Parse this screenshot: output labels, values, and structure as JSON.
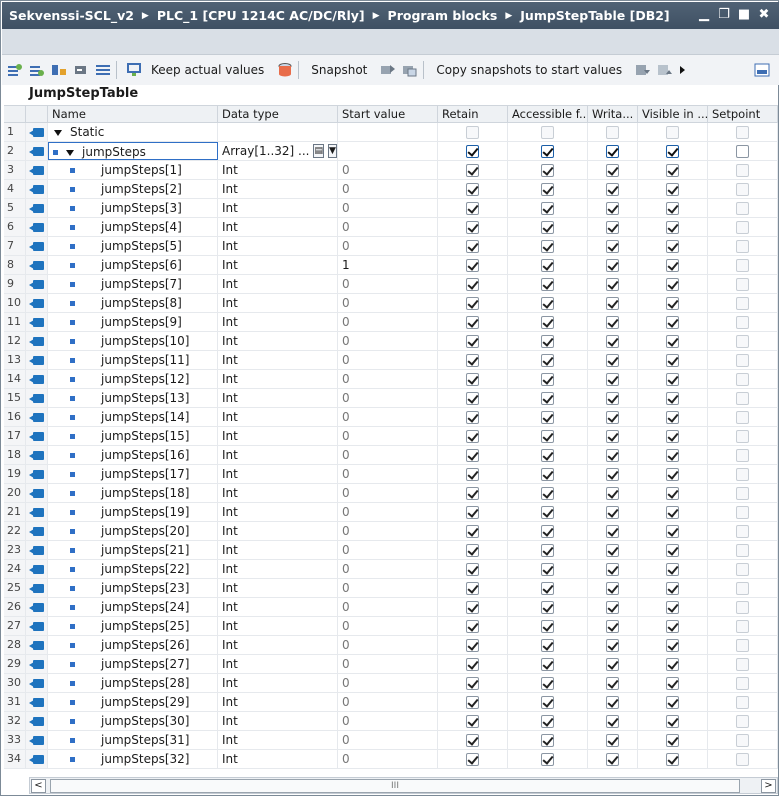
{
  "title": {
    "breadcrumb": [
      "Sekvenssi-SCL_v2",
      "PLC_1 [CPU 1214C AC/DC/Rly]",
      "Program blocks",
      "JumpStepTable [DB2]"
    ],
    "controls": [
      "▁",
      "❐",
      "■",
      "✖"
    ]
  },
  "toolbar": {
    "keep_actual": "Keep actual values",
    "snapshot": "Snapshot",
    "copy_snapshots": "Copy snapshots to start values"
  },
  "block_name": "JumpStepTable",
  "columns": {
    "name": "Name",
    "data_type": "Data type",
    "start_value": "Start value",
    "retain": "Retain",
    "accessible": "Accessible f...",
    "writable": "Writa...",
    "visible": "Visible in ...",
    "setpoint": "Setpoint"
  },
  "rows": [
    {
      "num": "1",
      "name": "Static",
      "type": "",
      "start": ""
    },
    {
      "num": "2",
      "name": "jumpSteps",
      "type": "Array[1..32] ...",
      "start": ""
    },
    {
      "num": "3",
      "name": "jumpSteps[1]",
      "type": "Int",
      "start": "0"
    },
    {
      "num": "4",
      "name": "jumpSteps[2]",
      "type": "Int",
      "start": "0"
    },
    {
      "num": "5",
      "name": "jumpSteps[3]",
      "type": "Int",
      "start": "0"
    },
    {
      "num": "6",
      "name": "jumpSteps[4]",
      "type": "Int",
      "start": "0"
    },
    {
      "num": "7",
      "name": "jumpSteps[5]",
      "type": "Int",
      "start": "0"
    },
    {
      "num": "8",
      "name": "jumpSteps[6]",
      "type": "Int",
      "start": "1"
    },
    {
      "num": "9",
      "name": "jumpSteps[7]",
      "type": "Int",
      "start": "0"
    },
    {
      "num": "10",
      "name": "jumpSteps[8]",
      "type": "Int",
      "start": "0"
    },
    {
      "num": "11",
      "name": "jumpSteps[9]",
      "type": "Int",
      "start": "0"
    },
    {
      "num": "12",
      "name": "jumpSteps[10]",
      "type": "Int",
      "start": "0"
    },
    {
      "num": "13",
      "name": "jumpSteps[11]",
      "type": "Int",
      "start": "0"
    },
    {
      "num": "14",
      "name": "jumpSteps[12]",
      "type": "Int",
      "start": "0"
    },
    {
      "num": "15",
      "name": "jumpSteps[13]",
      "type": "Int",
      "start": "0"
    },
    {
      "num": "16",
      "name": "jumpSteps[14]",
      "type": "Int",
      "start": "0"
    },
    {
      "num": "17",
      "name": "jumpSteps[15]",
      "type": "Int",
      "start": "0"
    },
    {
      "num": "18",
      "name": "jumpSteps[16]",
      "type": "Int",
      "start": "0"
    },
    {
      "num": "19",
      "name": "jumpSteps[17]",
      "type": "Int",
      "start": "0"
    },
    {
      "num": "20",
      "name": "jumpSteps[18]",
      "type": "Int",
      "start": "0"
    },
    {
      "num": "21",
      "name": "jumpSteps[19]",
      "type": "Int",
      "start": "0"
    },
    {
      "num": "22",
      "name": "jumpSteps[20]",
      "type": "Int",
      "start": "0"
    },
    {
      "num": "23",
      "name": "jumpSteps[21]",
      "type": "Int",
      "start": "0"
    },
    {
      "num": "24",
      "name": "jumpSteps[22]",
      "type": "Int",
      "start": "0"
    },
    {
      "num": "25",
      "name": "jumpSteps[23]",
      "type": "Int",
      "start": "0"
    },
    {
      "num": "26",
      "name": "jumpSteps[24]",
      "type": "Int",
      "start": "0"
    },
    {
      "num": "27",
      "name": "jumpSteps[25]",
      "type": "Int",
      "start": "0"
    },
    {
      "num": "28",
      "name": "jumpSteps[26]",
      "type": "Int",
      "start": "0"
    },
    {
      "num": "29",
      "name": "jumpSteps[27]",
      "type": "Int",
      "start": "0"
    },
    {
      "num": "30",
      "name": "jumpSteps[28]",
      "type": "Int",
      "start": "0"
    },
    {
      "num": "31",
      "name": "jumpSteps[29]",
      "type": "Int",
      "start": "0"
    },
    {
      "num": "32",
      "name": "jumpSteps[30]",
      "type": "Int",
      "start": "0"
    },
    {
      "num": "33",
      "name": "jumpSteps[31]",
      "type": "Int",
      "start": "0"
    },
    {
      "num": "34",
      "name": "jumpSteps[32]",
      "type": "Int",
      "start": "0"
    }
  ],
  "scrollbar": {
    "thumb": "III",
    "left": "<",
    "right": ">"
  }
}
